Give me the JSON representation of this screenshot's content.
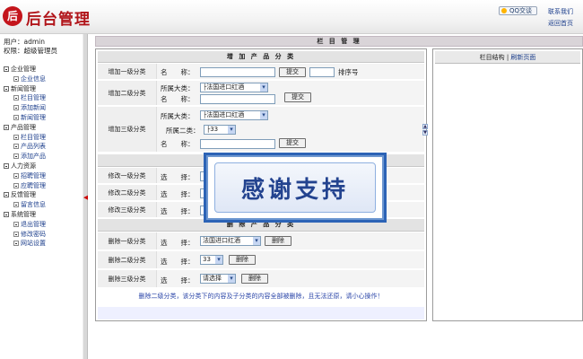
{
  "header": {
    "logo_glyph": "后",
    "brand": "后台管理",
    "qq_label": "QQ交谈",
    "contact": "联系我们",
    "home": "返回首页"
  },
  "user": {
    "label": "用户：admin",
    "role": "权限：超级管理员"
  },
  "sidebar": [
    {
      "group": "企业管理",
      "items": [
        "企业信息"
      ]
    },
    {
      "group": "新闻管理",
      "items": [
        "栏目管理",
        "添加新闻",
        "新闻管理"
      ]
    },
    {
      "group": "产品管理",
      "items": [
        "栏目管理",
        "产品列表",
        "添加产品"
      ]
    },
    {
      "group": "人力资源",
      "items": [
        "招聘管理",
        "应聘管理"
      ]
    },
    {
      "group": "反馈管理",
      "items": [
        "留言信息"
      ]
    },
    {
      "group": "系统管理",
      "items": [
        "退出管理",
        "修改密码",
        "网站设置"
      ]
    }
  ],
  "page_title": "栏 目 管 理",
  "add_section": {
    "title": "增 加 产 品 分 类",
    "level1": {
      "label": "增加一级分类",
      "name_label": "名　　称：",
      "submit": "提交",
      "order_label": "排序号"
    },
    "level2": {
      "label": "增加二级分类",
      "parent_label": "所属大类：",
      "parent_value": "├法国进口红酒",
      "name_label": "名　　称：",
      "submit": "提交"
    },
    "level3": {
      "label": "增加三级分类",
      "parent_label": "所属大类：",
      "parent_value": "├法国进口红酒",
      "sub_label": "所属二类：",
      "sub_value": "├33",
      "name_label": "名　　称：",
      "submit": "提交"
    }
  },
  "modify_section": {
    "rows": [
      {
        "label": "修改一级分类",
        "select_label": "选　　择："
      },
      {
        "label": "修改二级分类",
        "select_label": "选　　择："
      },
      {
        "label": "修改三级分类",
        "select_label": "选　　择："
      }
    ]
  },
  "delete_section": {
    "title": "删 除 产 品 分 类",
    "rows": [
      {
        "label": "删除一级分类",
        "select_label": "选　　择：",
        "value": "法国进口红酒",
        "button": "删除"
      },
      {
        "label": "删除二级分类",
        "select_label": "选　　择：",
        "value": "33",
        "button": "删除"
      },
      {
        "label": "删除三级分类",
        "select_label": "选　　择：",
        "value": "请选择",
        "button": "删除"
      }
    ]
  },
  "warning": "删除二级分类，该分类下的内容及子分类的内容全部被删除，且无法还原，请小心操作！",
  "right_panel": {
    "structure": "栏目结构",
    "separator": "|",
    "refresh": "刷新页面"
  },
  "overlay": {
    "text": "感谢支持"
  },
  "colors": {
    "brand": "#b1151a",
    "link": "#1d3f8c",
    "accent": "#2c63b6"
  }
}
